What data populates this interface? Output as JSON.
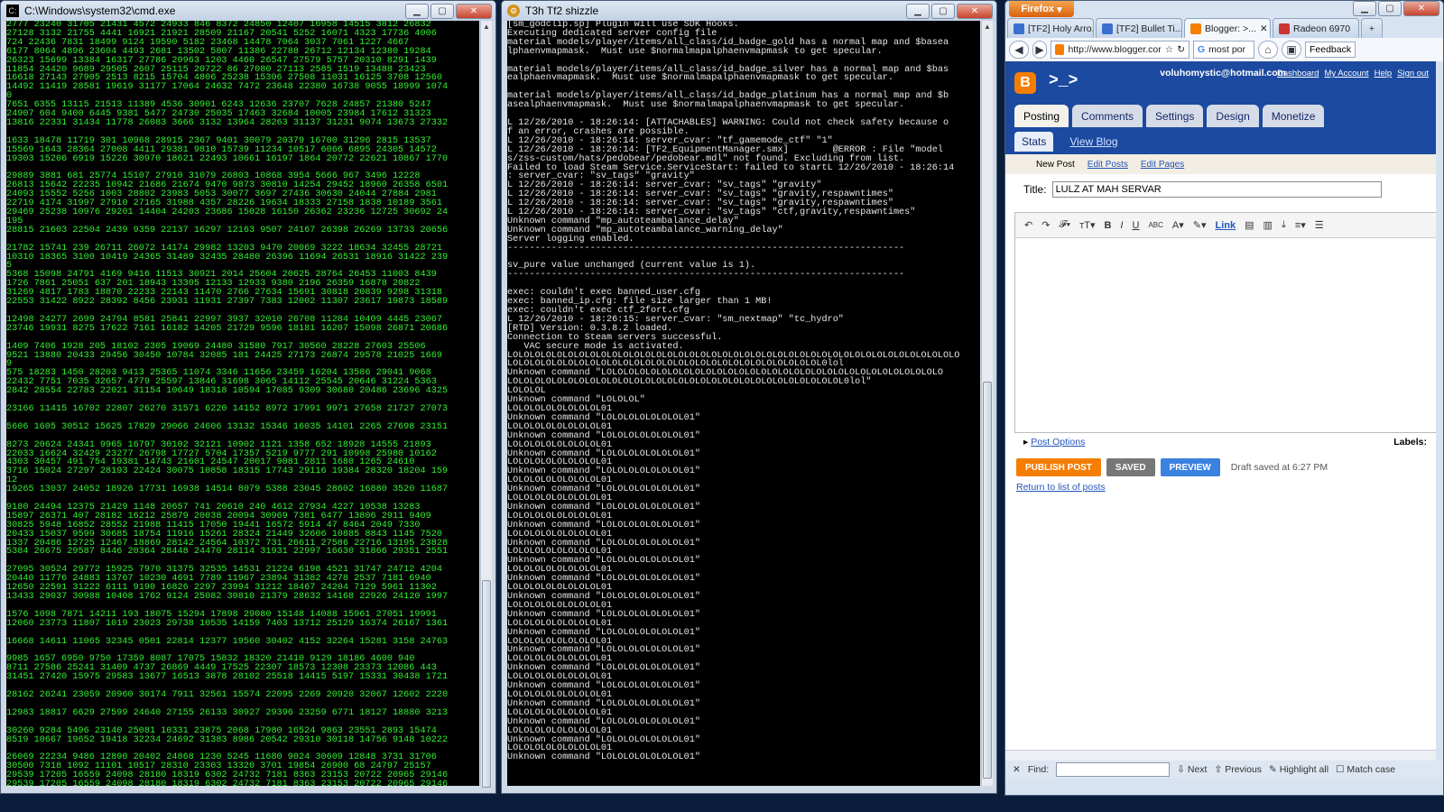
{
  "cmd": {
    "title": "C:\\Windows\\system32\\cmd.exe",
    "lines": [
      "2777 23240 31705 21431 4572 24933 846 8372 24850 12407 16958 14515 3812 26832",
      "27128 3132 21755 4441 16921 21921 28509 21167 20541 5252 16071 4323 17736 4006",
      "724 22436 7831 18499 9124 19590 5182 23468 14478 7064 3037 7061 1227 4667",
      "6177 8064 4896 23604 4493 2681 13502 5807 11386 22788 26712 12134 12380 19284",
      "26323 15699 13384 16317 27786 20963 1203 4460 26547 27579 5757 20310 8291 1439",
      "11854 24420 9689 29505 2607 25115 20722 86 27080 27113 2585 1519 13488 23423",
      "16618 27143 27905 2513 8215 15704 4806 25238 15306 27508 11031 16125 3708 12560",
      "14492 11419 28581 19619 31177 17064 24632 7472 23648 22380 16738 9055 18999 1074",
      "0",
      "7651 6355 13115 21513 11389 4536 30901 6243 12636 23707 7628 24857 21380 5247",
      "24907 604 9400 6445 9381 5477 24730 25035 17463 32684 10005 23984 17612 31323",
      "13816 22331 31434 11778 26083 3666 3132 13964 28263 31137 31231 9074 13673 27332",
      "",
      "1633 18478 11719 301 10968 28915 2367 9401 30079 20379 16700 31296 2815 13537",
      "15569 1643 28364 27008 4411 29381 9810 15739 11234 10517 6066 6895 24305 14572",
      "19303 15206 6919 15226 30970 18621 22493 10661 16197 1864 20772 22621 10867 1770",
      "",
      "29889 3881 681 25774 15107 27910 31079 26803 10868 3954 5666 967 3496 12228",
      "26813 15642 22235 10942 21686 21674 9470 9873 30810 14254 29452 18960 26358 6501",
      "24093 15552 5256 1003 28802 23983 5053 30077 3697 27436 30630 24044 27884 2981",
      "22719 4174 31997 27910 27165 31988 4357 28226 19634 18333 27158 1838 10189 3561",
      "29469 25238 10976 29201 14404 24203 23686 15028 16150 26362 23236 12725 30692 24",
      "195",
      "28815 21603 22504 2439 9359 22137 16297 12163 9507 24167 26398 26269 13733 20656",
      "",
      "21782 15741 239 26711 26072 14174 29982 13203 9470 20069 3222 18634 32455 28721",
      "10310 18365 3100 10419 24365 31489 32435 28480 26396 11694 26531 18916 31422 239",
      "5",
      "5368 15098 24791 4169 9416 11513 30921 2014 25604 20625 28764 26453 11003 8439",
      "1726 7861 25051 637 201 18943 13305 12133 12933 9380 2196 26359 16878 20822",
      "31269 4817 1783 18870 22233 22143 11470 2766 27634 15691 30818 20839 9298 31318",
      "22553 31422 8922 28392 8456 23931 11931 27397 7383 12002 11307 23617 19873 18589",
      "",
      "12498 24277 2699 24794 8581 25841 22997 3937 32010 26708 11284 10409 4445 23067",
      "23746 19931 8275 17622 7161 16182 14205 21729 9596 18181 16207 15098 26871 20686",
      "",
      "1409 7406 1928 205 18102 2305 19069 24480 31580 7917 30560 28228 27603 25506",
      "9521 13880 20433 29456 30450 10784 32085 181 24425 27173 26874 29578 21025 1669",
      "9",
      "575 18283 1450 28203 9413 25365 11074 3346 11656 23459 16204 13586 29041 9068",
      "22432 7751 7035 32657 4779 25597 13846 31698 3065 14112 25545 20646 31224 5363",
      "2842 28554 22783 22021 31154 10649 18318 10594 17085 9309 30680 20486 23696 4325",
      "",
      "23166 11415 16702 22807 26270 31571 6220 14152 8972 17991 9971 27658 21727 27073",
      "",
      "5606 1605 30512 15625 17829 29066 24606 13132 15346 16035 14101 2265 27698 23151",
      "",
      "8273 20624 24341 9965 16797 30102 32121 10902 1121 1358 652 18928 14555 21893",
      "22033 16624 32429 23277 26798 17727 5704 17357 5219 9777 291 10998 25980 10162",
      "4303 30457 491 754 19381 14743 21601 24547 20017 9081 2811 1680 1265 24610",
      "3716 15024 27297 28193 22424 30075 10858 18315 17743 29116 19384 28320 18204 159",
      "12",
      "19265 13037 24052 18926 17731 16938 14514 8079 5388 23045 28602 16880 3520 11687",
      "",
      "9180 24494 12375 21429 1148 20657 741 20610 240 4612 27934 4227 10538 13283",
      "15897 26371 407 28182 16212 25879 20038 20094 30969 7381 6477 13806 2911 9409",
      "30825 5948 16852 28552 21988 11415 17050 19441 16572 5914 47 8464 2049 7330",
      "20433 15037 9599 30685 18754 11916 15261 28324 21449 32606 10885 8843 1145 7520",
      "1337 20486 12725 12467 18869 28142 24564 10372 731 26611 27586 22716 13195 23828",
      "5384 26675 29587 8446 20364 28448 24470 28114 31931 22997 16630 31866 29351 2551",
      "",
      "27095 30524 29772 15925 7970 31375 32535 14531 21224 6198 4521 31747 24712 4204",
      "20440 11776 24883 13767 10230 4691 7789 11967 23894 31382 4278 2537 7181 6940",
      "12650 22591 31222 6111 9190 16826 2297 23994 31212 18467 24204 7129 5961 11302",
      "13433 29037 30988 10408 1762 9124 25082 30810 21379 28632 14168 22926 24120 1997",
      "",
      "1576 1098 7871 14211 193 18075 15294 17898 29080 15148 14088 15961 27051 19991",
      "12060 23773 11807 1019 23023 29738 10535 14159 7403 13712 25129 16374 26167 1361",
      "",
      "16668 14611 11065 32345 0501 22814 12377 19560 30402 4152 32264 15281 3158 24763",
      "",
      "9985 1657 6950 9750 17359 8087 17075 15832 18320 21410 9129 18186 4600 940",
      "8711 27586 25241 31409 4737 26869 4449 17525 22307 18573 12308 23373 12086 443",
      "31451 27420 15975 29583 13677 16513 3878 28102 25518 14415 5197 15331 30438 1721",
      "",
      "28162 26241 23059 20960 30174 7911 32561 15574 22095 2269 20920 32067 12602 2220",
      "",
      "12983 18817 6629 27599 24640 27155 26133 30927 29396 23259 6771 18127 18880 3213",
      "",
      "30260 9284 5496 23140 25081 10331 23875 2068 17980 16524 9863 23551 2893 15474",
      "8519 10667 19652 19418 32234 24692 31383 8986 20542 29310 30118 14756 9148 10222",
      "",
      "26069 22234 9486 12890 20402 24868 1230 5245 11680 9024 30609 12848 3731 31706",
      "30500 7318 1092 11101 10517 28310 23303 13320 3701 19854 26900 68 24797 25157",
      "29539 17205 16559 24098 28180 18319 6302 24732 7181 8363 23153 20722 20965 29146",
      "29539 17205 16559 24098 28180 18319 6302 24732 7181 8363 23153 20722 20965 29146"
    ]
  },
  "srcds": {
    "title": "T3h Tf2 shizzle",
    "lines": [
      "[sm_godclip.sp] Plugin will use SDK Hooks.",
      "Executing dedicated server config file",
      "material models/player/items/all_class/id_badge_gold has a normal map and $basea",
      "lphaenvmapmask.  Must use $normalmapalphaenvmapmask to get specular.",
      "",
      "material models/player/items/all_class/id_badge_silver has a normal map and $bas",
      "ealphaenvmapmask.  Must use $normalmapalphaenvmapmask to get specular.",
      "",
      "material models/player/items/all_class/id_badge_platinum has a normal map and $b",
      "asealphaenvmapmask.  Must use $normalmapalphaenvmapmask to get specular.",
      "",
      "L 12/26/2010 - 18:26:14: [ATTACHABLES] WARNING: Could not check safety because o",
      "f an error, crashes are possible.",
      "L 12/26/2010 - 18:26:14: server_cvar: \"tf_gamemode_ctf\" \"1\"",
      "L 12/26/2010 - 18:26:14: [TF2_EquipmentManager.smx]        @ERROR : File \"model",
      "s/zss-custom/hats/pedobear/pedobear.mdl\" not found. Excluding from list.",
      "Failed to load Steam Service.ServiceStart: failed to startL 12/26/2010 - 18:26:14",
      ": server_cvar: \"sv_tags\" \"gravity\"",
      "L 12/26/2010 - 18:26:14: server_cvar: \"sv_tags\" \"gravity\"",
      "L 12/26/2010 - 18:26:14: server_cvar: \"sv_tags\" \"gravity,respawntimes\"",
      "L 12/26/2010 - 18:26:14: server_cvar: \"sv_tags\" \"gravity,respawntimes\"",
      "L 12/26/2010 - 18:26:14: server_cvar: \"sv_tags\" \"ctf,gravity,respawntimes\"",
      "Unknown command \"mp_autoteambalance_delay\"",
      "Unknown command \"mp_autoteambalance_warning_delay\"",
      "Server logging enabled.",
      "------------------------------------------------------------------------",
      "",
      "sv_pure value unchanged (current value is 1).",
      "------------------------------------------------------------------------",
      "",
      "exec: couldn't exec banned_user.cfg",
      "exec: banned_ip.cfg: file size larger than 1 MB!",
      "exec: couldn't exec ctf_2fort.cfg",
      "L 12/26/2010 - 18:26:15: server_cvar: \"sm_nextmap\" \"tc_hydro\"",
      "[RTD] Version: 0.3.8.2 loaded.",
      "Connection to Steam servers successful.",
      "   VAC secure mode is activated.",
      "LOLOLOLOLOLOLOLOLOLOLOLOLOLOLOLOLOLOLOLOLOLOLOLOLOLOLOLOLOLOLOLOLOLOLOLOLOLOLOLOLO",
      "LOLOLOLOLOLOLOLOLOLOLOLOLOLOLOLOLOLOLOLOLOLOLOLOLOLOLOLOL0lol",
      "Unknown command \"LOLOLOLOLOLOLOLOLOLOLOLOLOLOLOLOLOLOLOLOLOLOLOLOLOLOLOLOLOLOLO",
      "LOLOLOLOLOLOLOLOLOLOLOLOLOLOLOLOLOLOLOLOLOLOLOLOLOLOLOLOLOLOL0lol\"",
      "LOLOLOL",
      "Unknown command \"LOLOLOL\"",
      "LOLOLOLOLOLOLOLOL01",
      "Unknown command \"LOLOLOLOLOLOLOL01\"",
      "LOLOLOLOLOLOLOLOL01",
      "Unknown command \"LOLOLOLOLOLOLOL01\"",
      "LOLOLOLOLOLOLOLOL01",
      "Unknown command \"LOLOLOLOLOLOLOL01\"",
      "LOLOLOLOLOLOLOLOL01",
      "Unknown command \"LOLOLOLOLOLOLOL01\"",
      "LOLOLOLOLOLOLOLOL01",
      "Unknown command \"LOLOLOLOLOLOLOL01\"",
      "LOLOLOLOLOLOLOLOL01",
      "Unknown command \"LOLOLOLOLOLOLOL01\"",
      "LOLOLOLOLOLOLOLOL01",
      "Unknown command \"LOLOLOLOLOLOLOL01\"",
      "LOLOLOLOLOLOLOLOL01",
      "Unknown command \"LOLOLOLOLOLOLOL01\"",
      "LOLOLOLOLOLOLOLOL01",
      "Unknown command \"LOLOLOLOLOLOLOL01\"",
      "LOLOLOLOLOLOLOLOL01",
      "Unknown command \"LOLOLOLOLOLOLOL01\"",
      "LOLOLOLOLOLOLOLOL01",
      "Unknown command \"LOLOLOLOLOLOLOL01\"",
      "LOLOLOLOLOLOLOLOL01",
      "Unknown command \"LOLOLOLOLOLOLOL01\"",
      "LOLOLOLOLOLOLOLOL01",
      "Unknown command \"LOLOLOLOLOLOLOL01\"",
      "LOLOLOLOLOLOLOLOL01",
      "Unknown command \"LOLOLOLOLOLOLOL01\"",
      "LOLOLOLOLOLOLOLOL01",
      "Unknown command \"LOLOLOLOLOLOLOL01\"",
      "LOLOLOLOLOLOLOLOL01",
      "Unknown command \"LOLOLOLOLOLOLOL01\"",
      "LOLOLOLOLOLOLOLOL01",
      "Unknown command \"LOLOLOLOLOLOLOL01\"",
      "LOLOLOLOLOLOLOLOL01",
      "Unknown command \"LOLOLOLOLOLOLOL01\"",
      "LOLOLOLOLOLOLOLOL01",
      "Unknown command \"LOLOLOLOLOLOLOL01\"",
      "LOLOLOLOLOLOLOLOL01",
      "Unknown command \"LOLOLOLOLOLOLOL01\""
    ]
  },
  "firefox": {
    "menu_label": "Firefox",
    "tabs": [
      {
        "label": "[TF2] Holy Arro...",
        "color": "#3b6fcf"
      },
      {
        "label": "[TF2] Bullet Ti...",
        "color": "#3b6fcf"
      },
      {
        "label": "Blogger: >...",
        "color": "#f57d00"
      },
      {
        "label": "Radeon 6970",
        "color": "#c33"
      }
    ],
    "url": "http://www.blogger.cor",
    "search_text": "most por",
    "feedback_label": "Feedback",
    "find_label": "Find:",
    "find_next": "Next",
    "find_previous": "Previous",
    "highlight_all": "Highlight all",
    "match_case": "Match case"
  },
  "blogger": {
    "logo_letter": "B",
    "blog_title": ">_>",
    "email": "voluhomystic@hotmail.com",
    "links": [
      "Dashboard",
      "My Account",
      "Help",
      "Sign out"
    ],
    "tabs": [
      "Posting",
      "Comments",
      "Settings",
      "Design",
      "Monetize"
    ],
    "subtabs": [
      "Stats",
      "View Blog"
    ],
    "post_tabs": [
      "New Post",
      "Edit Posts",
      "Edit Pages"
    ],
    "title_label": "Title:",
    "title_value": "LULZ AT MAH SERVAR",
    "link_label": "Link",
    "post_options": "Post Options",
    "labels_label": "Labels:",
    "publish": "PUBLISH POST",
    "saved": "SAVED",
    "preview": "PREVIEW",
    "draft_status": "Draft saved at 6:27 PM",
    "return_link": "Return to list of posts"
  }
}
